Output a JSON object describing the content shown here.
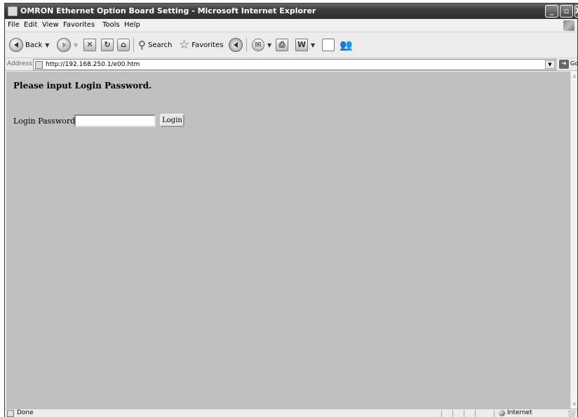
{
  "window": {
    "title": "OMRON Ethernet Option Board Setting - Microsoft Internet Explorer",
    "minimize": "_",
    "maximize": "▫",
    "close": "X"
  },
  "menu": {
    "items": [
      "File",
      "Edit",
      "View",
      "Favorites",
      "Tools",
      "Help"
    ]
  },
  "toolbar": {
    "back_label": "Back",
    "search_label": "Search",
    "favorites_label": "Favorites",
    "word_glyph": "W"
  },
  "address": {
    "label": "Address",
    "url": "http://192.168.250.1/e00.htm",
    "go_label": "Go"
  },
  "page": {
    "heading": "Please input Login Password.",
    "password_label": "Login Password :",
    "password_value": "",
    "login_button": "Login"
  },
  "status": {
    "text": "Done",
    "zone": "Internet"
  },
  "colors": {
    "page_background": "#c0c0c0",
    "titlebar": "#3c3c3c"
  }
}
